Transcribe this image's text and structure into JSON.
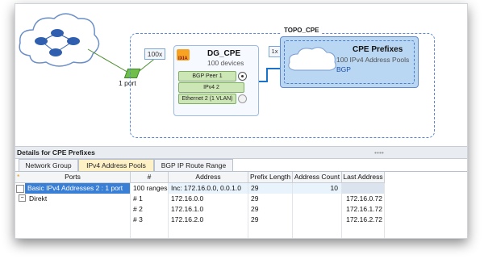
{
  "topology": {
    "title": "TOPO_CPE",
    "port_label": "1 port",
    "device_group": {
      "multiplier": "100x",
      "logo_text": "IXIA",
      "name": "DG_CPE",
      "subtitle": "100 devices",
      "stack": [
        "BGP Peer 1",
        "IPv4 2",
        "Ethernet 2 (1 VLAN)"
      ]
    },
    "network_group": {
      "multiplier": "1x",
      "name": "CPE Prefixes",
      "subtitle": "100 IPv4 Address Pools",
      "protocol": "BGP"
    }
  },
  "details": {
    "title": "Details for CPE Prefixes",
    "tabs": [
      "Network Group",
      "IPv4 Address Pools",
      "BGP IP Route Range"
    ],
    "active_tab": 1
  },
  "table": {
    "columns": [
      "Ports",
      "#",
      "Address",
      "Prefix Length",
      "Address Count",
      "Last Address"
    ],
    "rows": [
      {
        "ports": "Basic IPv4 Addresses 2 : 1 port",
        "num": "100 ranges",
        "address": "Inc: 172.16.0.0, 0.0.1.0",
        "prefix": "29",
        "count": "10",
        "last": ""
      },
      {
        "ports": "Direkt",
        "num": "# 1",
        "address": "172.16.0.0",
        "prefix": "29",
        "count": "",
        "last": "172.16.0.72"
      },
      {
        "ports": "",
        "num": "# 2",
        "address": "172.16.1.0",
        "prefix": "29",
        "count": "",
        "last": "172.16.1.72"
      },
      {
        "ports": "",
        "num": "# 3",
        "address": "172.16.2.0",
        "prefix": "29",
        "count": "",
        "last": "172.16.2.72"
      }
    ]
  },
  "colors": {
    "accent": "#5b8bd6",
    "selection": "#3a7fd6",
    "tab_active": "#fff1c6",
    "stack_green": "#cde6b5"
  }
}
